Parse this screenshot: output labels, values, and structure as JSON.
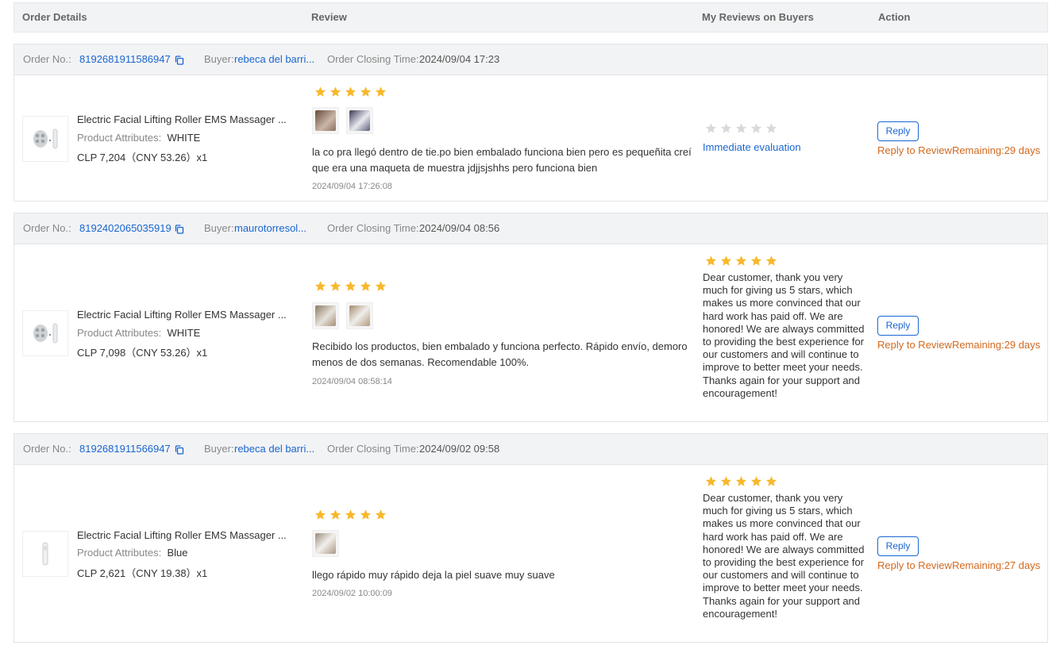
{
  "header": {
    "order_details": "Order Details",
    "review": "Review",
    "my_reviews": "My Reviews on Buyers",
    "action": "Action"
  },
  "labels": {
    "order_no": "Order No.:",
    "buyer": "Buyer:",
    "closing_time": "Order Closing Time:",
    "product_attributes": "Product Attributes:",
    "immediate_evaluation": "Immediate evaluation",
    "reply": "Reply",
    "reply_to_review": "Reply to Review",
    "remaining_prefix": "Remaining:"
  },
  "colors": {
    "link": "#1a66d1",
    "star_filled": "#f7b82b",
    "star_empty": "#d9d9d9",
    "remaining": "#d2691e"
  },
  "orders": [
    {
      "order_no": "8192681911586947",
      "buyer": "rebeca del barri...",
      "closing_time": "2024/09/04 17:23",
      "product_title": "Electric Facial Lifting Roller EMS Massager ...",
      "attribute": "WHITE",
      "price": "CLP 7,204（CNY  53.26）x1",
      "rating": 5,
      "review_images": 2,
      "review_text": "la co pra llegó dentro de tie.po bien embalado funciona bien pero es pequeñita creí que era una maqueta de muestra jdjjsjshhs pero funciona bien",
      "review_date": "2024/09/04 17:26:08",
      "my_rating": 0,
      "my_review": "",
      "remaining": "29 days"
    },
    {
      "order_no": "8192402065035919",
      "buyer": "maurotorresol...",
      "closing_time": "2024/09/04 08:56",
      "product_title": "Electric Facial Lifting Roller EMS Massager ...",
      "attribute": "WHITE",
      "price": "CLP 7,098（CNY  53.26）x1",
      "rating": 5,
      "review_images": 2,
      "review_text": "Recibido los productos, bien embalado y funciona perfecto. Rápido envío, demoro menos de dos semanas. Recomendable 100%.",
      "review_date": "2024/09/04 08:58:14",
      "my_rating": 5,
      "my_review": "Dear customer, thank you very much for giving us 5 stars, which makes us more convinced that our hard work has paid off. We are honored! We are always committed to providing the best experience for our customers and will continue to improve to better meet your needs. Thanks again for your support and encouragement!",
      "remaining": "29 days"
    },
    {
      "order_no": "8192681911566947",
      "buyer": "rebeca del barri...",
      "closing_time": "2024/09/02 09:58",
      "product_title": "Electric Facial Lifting Roller EMS Massager ...",
      "attribute": "Blue",
      "price": "CLP 2,621（CNY  19.38）x1",
      "rating": 5,
      "review_images": 1,
      "review_text": "llego rápido muy rápido deja la piel suave muy suave",
      "review_date": "2024/09/02 10:00:09",
      "my_rating": 5,
      "my_review": "Dear customer, thank you very much for giving us 5 stars, which makes us more convinced that our hard work has paid off. We are honored! We are always committed to providing the best experience for our customers and will continue to improve to better meet your needs. Thanks again for your support and encouragement!",
      "remaining": "27 days"
    }
  ]
}
